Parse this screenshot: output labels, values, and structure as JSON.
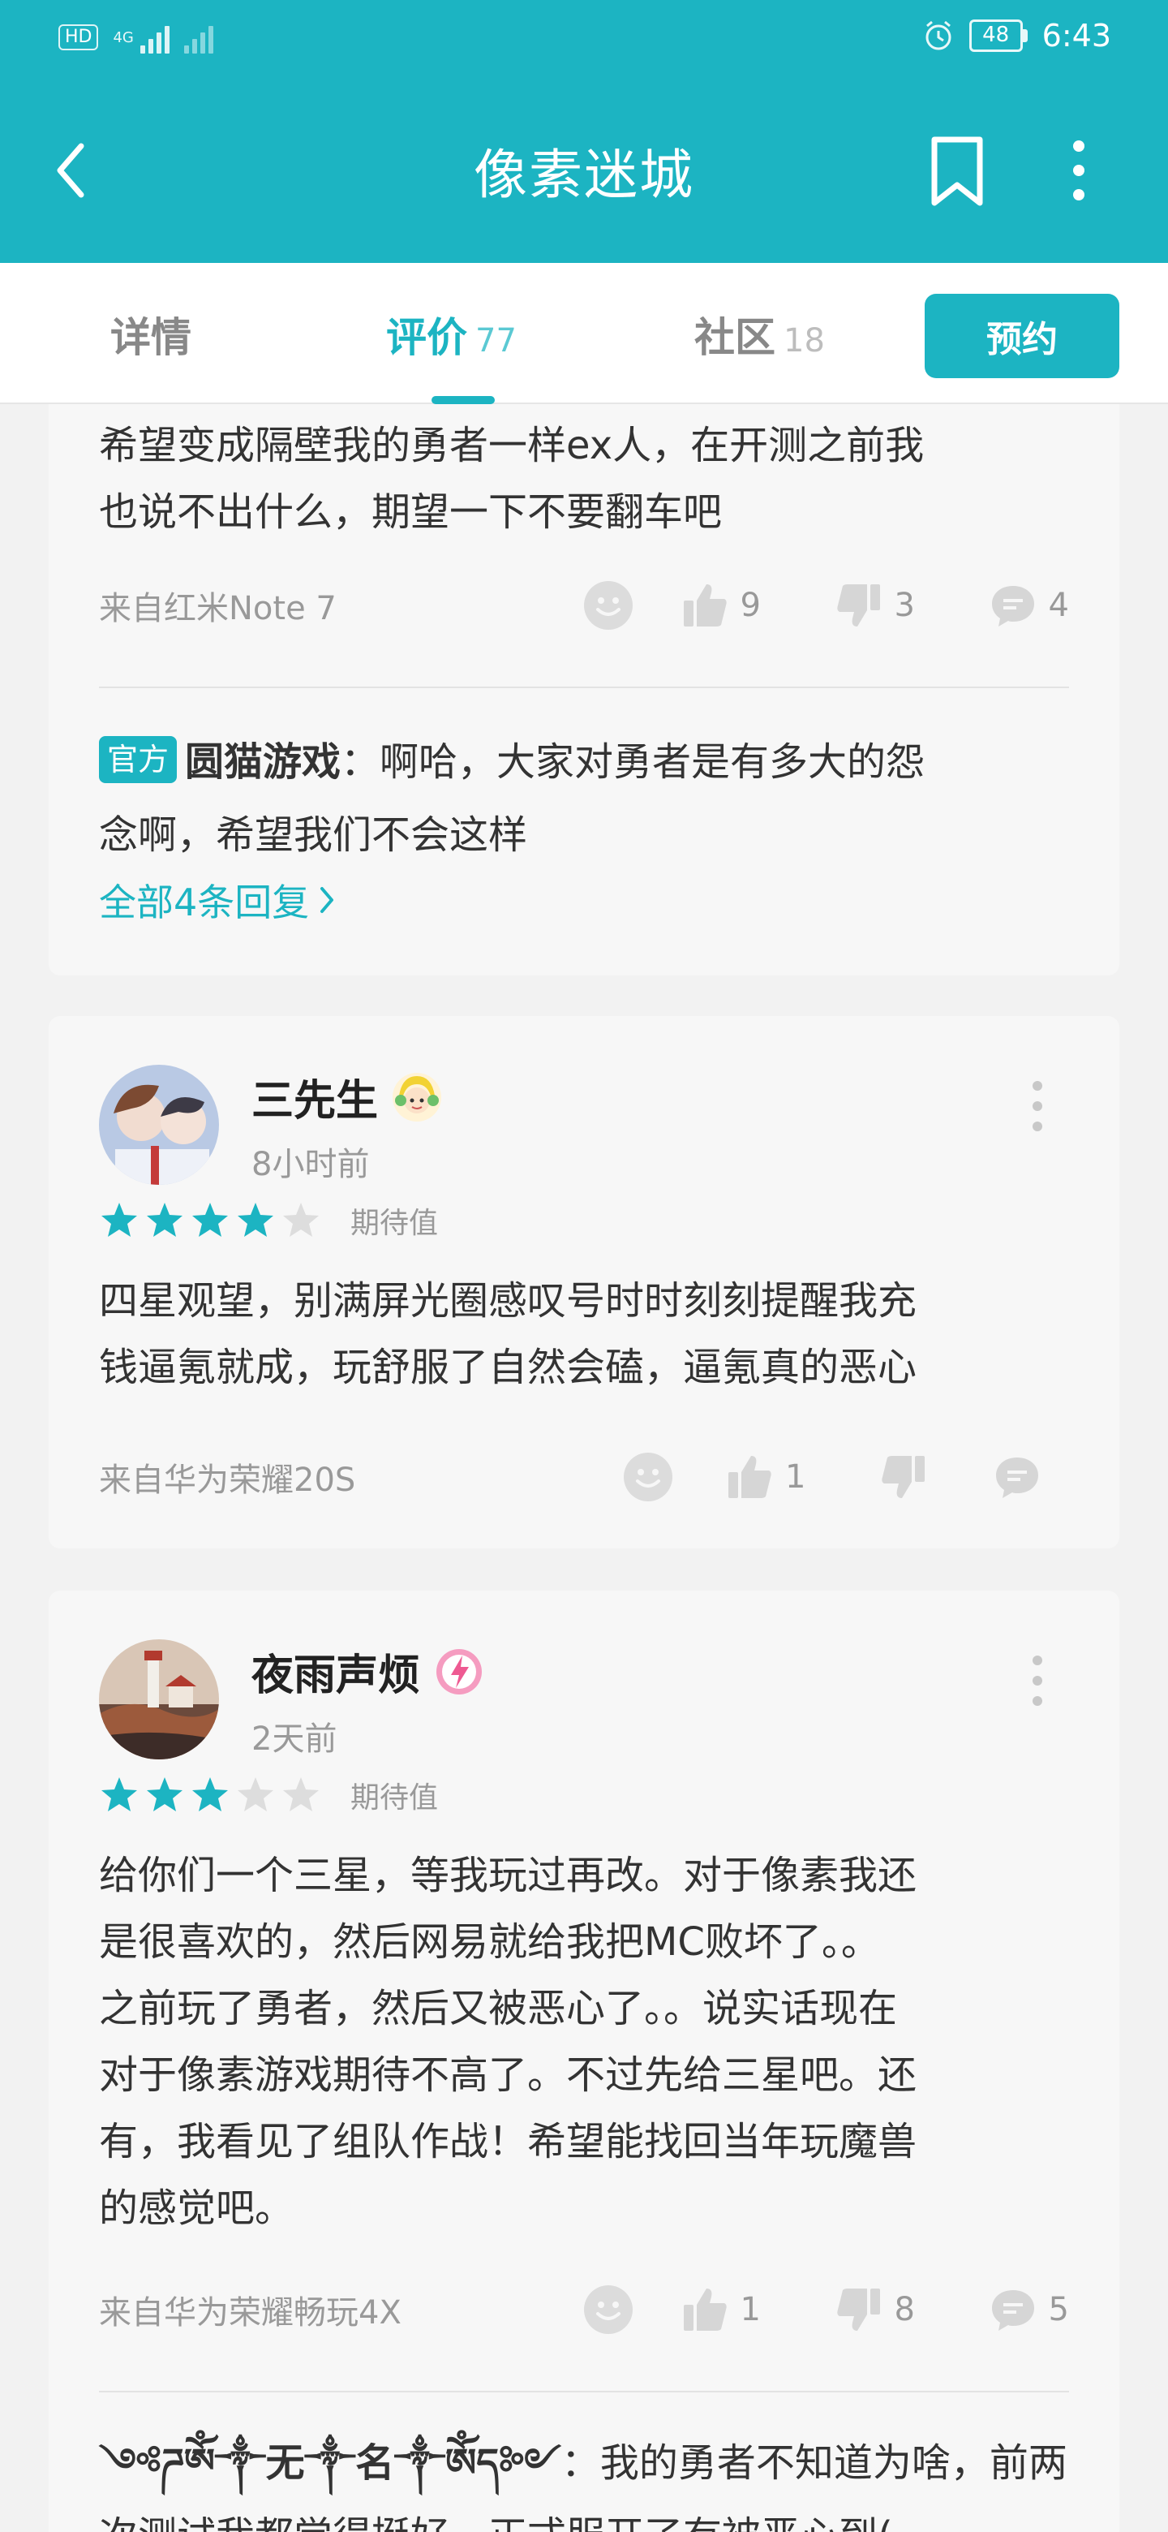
{
  "status_bar": {
    "hd": "HD",
    "network": "4G",
    "battery": "48",
    "time": "6:43"
  },
  "header": {
    "title": "像素迷城"
  },
  "tabs": [
    {
      "label": "详情",
      "count": ""
    },
    {
      "label": "评价",
      "count": "77"
    },
    {
      "label": "社区",
      "count": "18"
    }
  ],
  "reserve_label": "预约",
  "review0": {
    "text_line1": "希望变成隔壁我的勇者一样ex人，在开测之前我",
    "text_line2": "也说不出什么，期望一下不要翻车吧",
    "device": "来自红米Note 7",
    "likes": "9",
    "dislikes": "3",
    "comments": "4",
    "reply": {
      "badge": "官方",
      "author": "圆猫游戏",
      "text_line1": "：啊哈，大家对勇者是有多大的怨",
      "text_line2": "念啊，希望我们不会这样"
    },
    "all_replies": "全部4条回复"
  },
  "review1": {
    "username": "三先生",
    "time": "8小时前",
    "stars": 4,
    "rating_label": "期待值",
    "text_line1": "四星观望，别满屏光圈感叹号时时刻刻提醒我充",
    "text_line2": "钱逼氪就成，玩舒服了自然会磕，逼氪真的恶心",
    "device": "来自华为荣耀20S",
    "likes": "1",
    "dislikes": "",
    "comments": ""
  },
  "review2": {
    "username": "夜雨声烦",
    "time": "2天前",
    "stars": 3,
    "rating_label": "期待值",
    "text_line1": "给你们一个三星，等我玩过再改。对于像素我还",
    "text_line2": "是很喜欢的，然后网易就给我把MC败坏了。。",
    "text_line3": "之前玩了勇者，然后又被恶心了。。说实话现在",
    "text_line4": "对于像素游戏期待不高了。不过先给三星吧。还",
    "text_line5": "有，我看见了组队作战！希望能找回当年玩魔兽",
    "text_line6": "的感觉吧。",
    "device": "来自华为荣耀畅玩4X",
    "likes": "1",
    "dislikes": "8",
    "comments": "5",
    "reply": {
      "author": "༺ཌༀ༒无༒名༒ༀད༻",
      "text_line1": "：我的勇者不知道为啥，前两",
      "text_line2": "次测试我都觉得挺好，正式服开了有被恶心到("
    }
  },
  "colors": {
    "accent": "#1cb4c2",
    "star_on": "#1cb4c2",
    "star_off": "#dddddd",
    "meta": "#999999"
  },
  "icons": [
    "back-icon",
    "bookmark-icon",
    "more-vertical-icon",
    "emoji-icon",
    "thumbs-up-icon",
    "thumbs-down-icon",
    "comment-icon",
    "chevron-right-icon",
    "star-icon",
    "alarm-icon",
    "signal-icon",
    "battery-icon"
  ]
}
